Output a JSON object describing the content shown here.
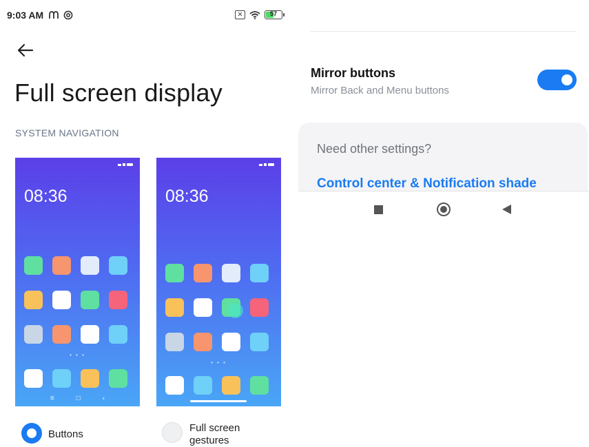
{
  "status_bar": {
    "time": "9:03 AM",
    "notification_icons": [
      "motorola-m-icon",
      "at-sign-icon"
    ],
    "battery_level": "57",
    "battery_fraction": 0.57
  },
  "header": {
    "back_icon": "arrow-left-icon",
    "title": "Full screen display"
  },
  "system_navigation": {
    "section_label": "SYSTEM NAVIGATION",
    "options": [
      {
        "label": "Buttons",
        "selected": true,
        "preview": {
          "clock": "08:36",
          "app_colors": [
            "#5fe0a0",
            "#f7956e",
            "#e3ecfb",
            "#6fd0f8",
            "#f8c15a",
            "#ffffff",
            "#5fe0a0",
            "#f5647a",
            "#c9d6e6",
            "#f7956e",
            "#ffffff",
            "#6fd0f8",
            "#ffffff",
            "#6fd0f8",
            "#f8c15a",
            "#5fe0a0"
          ],
          "nav_buttons": [
            "≡",
            "□",
            "‹"
          ]
        }
      },
      {
        "label": "Full screen gestures",
        "selected": false,
        "preview": {
          "clock": "08:36",
          "app_colors": [
            "#5fe0a0",
            "#f7956e",
            "#e3ecfb",
            "#6fd0f8",
            "#f8c15a",
            "#ffffff",
            "#5fe0a0",
            "#f5647a",
            "#c9d6e6",
            "#f7956e",
            "#ffffff",
            "#6fd0f8",
            "#ffffff",
            "#6fd0f8",
            "#f8c15a",
            "#5fe0a0"
          ]
        }
      }
    ]
  },
  "mirror_buttons": {
    "title": "Mirror buttons",
    "subtitle": "Mirror Back and Menu buttons",
    "enabled": true
  },
  "other_settings": {
    "title": "Need other settings?",
    "link": "Control center & Notification shade"
  },
  "navigation_bar": {
    "buttons": [
      "recents-square-icon",
      "home-circle-icon",
      "back-triangle-icon"
    ]
  },
  "colors": {
    "accent": "#1a7bf2",
    "section_label": "#6a7489",
    "card_bg": "#f4f4f6"
  }
}
